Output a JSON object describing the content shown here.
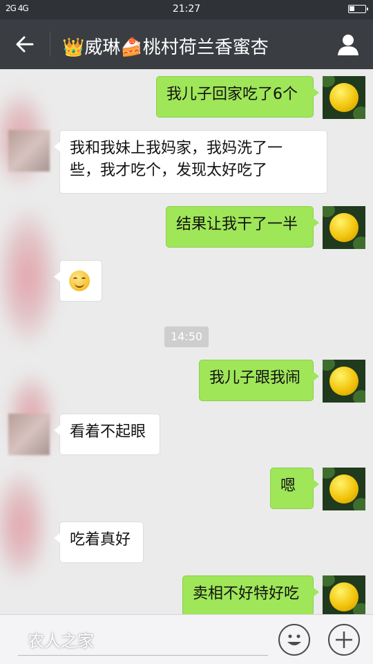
{
  "status_bar": {
    "signal": "2G 4G",
    "time": "21:27",
    "battery_level": 0.35
  },
  "header": {
    "title": "👑威琳🍰桃村荷兰香蜜杏"
  },
  "messages": [
    {
      "side": "right",
      "text": "我儿子回家吃了6个"
    },
    {
      "side": "left",
      "line1": "我和我妹上我妈家，我妈洗了一",
      "line2": "些，我才吃个，发现太好吃了"
    },
    {
      "side": "right",
      "text": "结果让我干了一半"
    },
    {
      "side": "left",
      "type": "emoji",
      "emoji": "smiley-emoji"
    },
    {
      "type": "time",
      "text": "14:50"
    },
    {
      "side": "right",
      "text": "我儿子跟我闹"
    },
    {
      "side": "left",
      "text": "看着不起眼"
    },
    {
      "side": "right",
      "text": "嗯"
    },
    {
      "side": "left",
      "text": "吃着真好"
    },
    {
      "side": "right",
      "text": "卖相不好特好吃"
    }
  ],
  "bottom_bar": {
    "watermark": "农人之家"
  },
  "icons": {
    "back": "arrow-left-icon",
    "contact": "person-icon",
    "emoji": "smiley-icon",
    "add": "plus-icon"
  },
  "colors": {
    "outgoing_bubble": "#9fe658",
    "incoming_bubble": "#ffffff",
    "header": "#3a3d42",
    "background": "#ebebeb"
  }
}
